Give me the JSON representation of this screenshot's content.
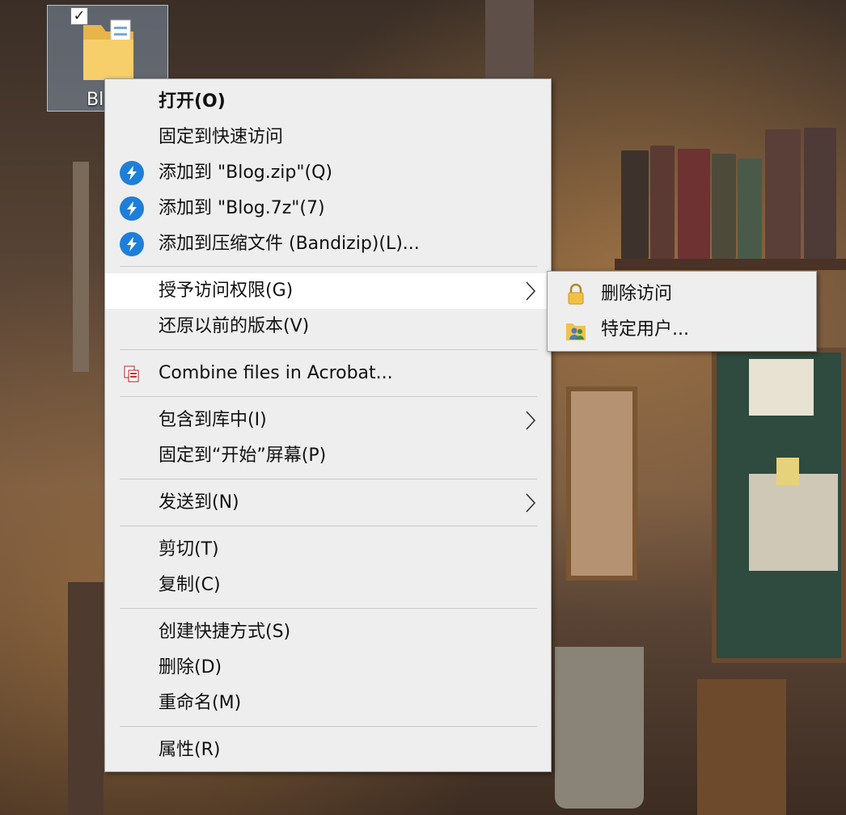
{
  "desktop": {
    "icon_label": "Bl",
    "icon_checked": true
  },
  "context_menu": {
    "items": [
      {
        "label": "打开(O)"
      },
      {
        "label": "固定到快速访问"
      },
      {
        "label": "添加到 \"Blog.zip\"(Q)",
        "icon": "bandizip-icon"
      },
      {
        "label": "添加到 \"Blog.7z\"(7)",
        "icon": "bandizip-icon"
      },
      {
        "label": "添加到压缩文件 (Bandizip)(L)...",
        "icon": "bandizip-icon"
      },
      {
        "label": "授予访问权限(G)",
        "has_submenu": true
      },
      {
        "label": "还原以前的版本(V)"
      },
      {
        "label": "Combine files in Acrobat...",
        "icon": "acrobat-combine-icon"
      },
      {
        "label": "包含到库中(I)",
        "has_submenu": true
      },
      {
        "label": "固定到“开始”屏幕(P)"
      },
      {
        "label": "发送到(N)",
        "has_submenu": true
      },
      {
        "label": "剪切(T)"
      },
      {
        "label": "复制(C)"
      },
      {
        "label": "创建快捷方式(S)"
      },
      {
        "label": "删除(D)"
      },
      {
        "label": "重命名(M)"
      },
      {
        "label": "属性(R)"
      }
    ]
  },
  "submenu": {
    "items": [
      {
        "label": "删除访问",
        "icon": "lock-icon"
      },
      {
        "label": "特定用户...",
        "icon": "users-icon"
      }
    ]
  },
  "colors": {
    "menu_bg": "#eeeeee",
    "hover_bg": "#ffffff",
    "bandizip_blue": "#1e7fd8",
    "separator": "#c8c8c8"
  }
}
